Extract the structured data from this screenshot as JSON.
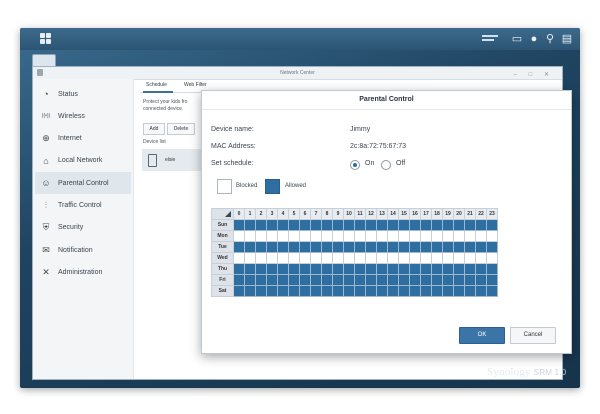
{
  "taskbar": {
    "status_text": "",
    "icons": [
      "chat-icon",
      "user-icon",
      "search-icon",
      "widgets-icon"
    ]
  },
  "window": {
    "title": "Network Center",
    "controls": "–  □  ✕"
  },
  "sidebar": {
    "items": [
      {
        "label": "Status",
        "icon": "status-icon",
        "glyph": "◔"
      },
      {
        "label": "Wireless",
        "icon": "wireless-icon",
        "glyph": "((•))"
      },
      {
        "label": "Internet",
        "icon": "internet-icon",
        "glyph": "⊕"
      },
      {
        "label": "Local Network",
        "icon": "local-network-icon",
        "glyph": "⌂"
      },
      {
        "label": "Parental Control",
        "icon": "parental-control-icon",
        "glyph": "☺"
      },
      {
        "label": "Traffic Control",
        "icon": "traffic-control-icon",
        "glyph": "⫶"
      },
      {
        "label": "Security",
        "icon": "security-icon",
        "glyph": "⛨"
      },
      {
        "label": "Notification",
        "icon": "notification-icon",
        "glyph": "✉"
      },
      {
        "label": "Administration",
        "icon": "administration-icon",
        "glyph": "✕"
      }
    ],
    "active_index": 4
  },
  "panel": {
    "tabs": [
      "Schedule",
      "Web Filter"
    ],
    "description": "Protect your kids fro connected device.",
    "add_label": "Add",
    "delete_label": "Delete",
    "device_list_header": "Device list",
    "device_name": "elsie"
  },
  "dialog": {
    "title": "Parental Control",
    "device_name_label": "Device name:",
    "device_name_value": "Jimmy",
    "mac_label": "MAC Address:",
    "mac_value": "2c:8a:72:75:67:73",
    "schedule_label": "Set schedule:",
    "schedule_on": "On",
    "schedule_off": "Off",
    "schedule_selected": "On",
    "legend_blocked": "Blocked",
    "legend_allowed": "Allowed",
    "hours": [
      "0",
      "1",
      "2",
      "3",
      "4",
      "5",
      "6",
      "7",
      "8",
      "9",
      "10",
      "11",
      "12",
      "13",
      "14",
      "15",
      "16",
      "17",
      "18",
      "19",
      "20",
      "21",
      "22",
      "23"
    ],
    "days": [
      {
        "label": "Sun",
        "allowed": [
          0,
          1,
          2,
          3,
          4,
          5,
          6,
          7,
          8,
          9,
          10,
          11,
          12,
          13,
          14,
          15,
          16,
          17,
          18,
          19,
          20,
          21,
          22,
          23
        ]
      },
      {
        "label": "Mon",
        "allowed": []
      },
      {
        "label": "Tue",
        "allowed": [
          0,
          1,
          2,
          3,
          4,
          5,
          6,
          7,
          8,
          9,
          10,
          11,
          12,
          13,
          14,
          15,
          16,
          17,
          18,
          19,
          20,
          21,
          22,
          23
        ]
      },
      {
        "label": "Wed",
        "allowed": []
      },
      {
        "label": "Thu",
        "allowed": [
          0,
          1,
          2,
          3,
          4,
          5,
          6,
          7,
          8,
          9,
          10,
          11,
          12,
          13,
          14,
          15,
          16,
          17,
          18,
          19,
          20,
          21,
          22,
          23
        ]
      },
      {
        "label": "Fri",
        "allowed": [
          0,
          1,
          2,
          3,
          4,
          5,
          6,
          7,
          8,
          9,
          10,
          11,
          12,
          13,
          14,
          15,
          16,
          17,
          18,
          19,
          20,
          21,
          22,
          23
        ]
      },
      {
        "label": "Sat",
        "allowed": [
          0,
          1,
          2,
          3,
          4,
          5,
          6,
          7,
          8,
          9,
          10,
          11,
          12,
          13,
          14,
          15,
          16,
          17,
          18,
          19,
          20,
          21,
          22,
          23
        ]
      }
    ],
    "ok_label": "OK",
    "cancel_label": "Cancel"
  },
  "branding": {
    "name": "Synology",
    "product": "SRM 1.0"
  },
  "colors": {
    "allowed": "#2f6ea0",
    "blocked": "#ffffff",
    "accent": "#3b74a6",
    "desktop": "#1f4461"
  }
}
